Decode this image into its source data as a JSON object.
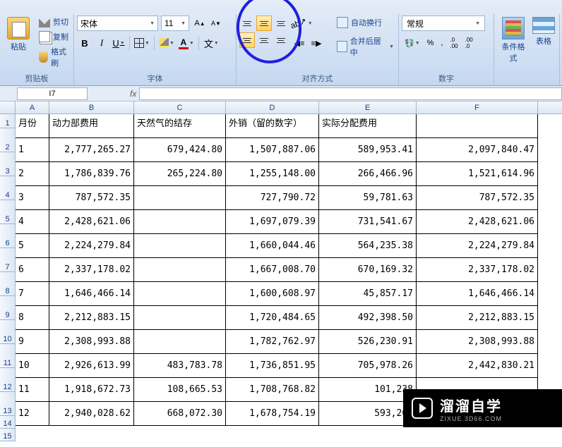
{
  "ribbon": {
    "clipboard": {
      "paste": "粘贴",
      "cut": "剪切",
      "copy": "复制",
      "format_painter": "格式刷",
      "group_label": "剪贴板"
    },
    "font": {
      "name": "宋体",
      "size": "11",
      "grow": "A",
      "shrink": "A",
      "bold": "B",
      "italic": "I",
      "underline": "U",
      "fontcolor_letter": "A",
      "wen": "文",
      "group_label": "字体"
    },
    "alignment": {
      "wrap": "自动换行",
      "merge": "合并后居中",
      "group_label": "对齐方式"
    },
    "number": {
      "format": "常规",
      "percent": "%",
      "comma": ",",
      "inc": ".0→.00",
      "dec": ".00→.0",
      "group_label": "数字"
    },
    "styles": {
      "cond_format": "条件格式",
      "table": "表格"
    }
  },
  "namebox": "I7",
  "fx": "fx",
  "columns": [
    "A",
    "B",
    "C",
    "D",
    "E",
    "F"
  ],
  "headers": {
    "A": "月份",
    "B": "动力部费用",
    "C": "天然气的结存",
    "D": "外销（留的数字）",
    "E": "实际分配费用",
    "F": ""
  },
  "rows": [
    {
      "n": "1",
      "A": "1",
      "B": "2,777,265.27",
      "C": "679,424.80",
      "D": "1,507,887.06",
      "E": "589,953.41",
      "F": "2,097,840.47"
    },
    {
      "n": "2",
      "A": "2",
      "B": "1,786,839.76",
      "C": "265,224.80",
      "D": "1,255,148.00",
      "E": "266,466.96",
      "F": "1,521,614.96"
    },
    {
      "n": "3",
      "A": "3",
      "B": "787,572.35",
      "C": "",
      "D": "727,790.72",
      "E": "59,781.63",
      "F": "787,572.35"
    },
    {
      "n": "4",
      "A": "4",
      "B": "2,428,621.06",
      "C": "",
      "D": "1,697,079.39",
      "E": "731,541.67",
      "F": "2,428,621.06"
    },
    {
      "n": "5",
      "A": "5",
      "B": "2,224,279.84",
      "C": "",
      "D": "1,660,044.46",
      "E": "564,235.38",
      "F": "2,224,279.84"
    },
    {
      "n": "6",
      "A": "6",
      "B": "2,337,178.02",
      "C": "",
      "D": "1,667,008.70",
      "E": "670,169.32",
      "F": "2,337,178.02"
    },
    {
      "n": "7",
      "A": "7",
      "B": "1,646,466.14",
      "C": "",
      "D": "1,600,608.97",
      "E": "45,857.17",
      "F": "1,646,466.14"
    },
    {
      "n": "8",
      "A": "8",
      "B": "2,212,883.15",
      "C": "",
      "D": "1,720,484.65",
      "E": "492,398.50",
      "F": "2,212,883.15"
    },
    {
      "n": "9",
      "A": "9",
      "B": "2,308,993.88",
      "C": "",
      "D": "1,782,762.97",
      "E": "526,230.91",
      "F": "2,308,993.88"
    },
    {
      "n": "10",
      "A": "10",
      "B": "2,926,613.99",
      "C": "483,783.78",
      "D": "1,736,851.95",
      "E": "705,978.26",
      "F": "2,442,830.21"
    },
    {
      "n": "11",
      "A": "11",
      "B": "1,918,672.73",
      "C": "108,665.53",
      "D": "1,708,768.82",
      "E": "101,238",
      "F": ""
    },
    {
      "n": "12",
      "A": "12",
      "B": "2,940,028.62",
      "C": "668,072.30",
      "D": "1,678,754.19",
      "E": "593,202",
      "F": ""
    }
  ],
  "watermark": {
    "main": "溜溜自学",
    "sub": "ZIXUE.3D66.COM"
  }
}
